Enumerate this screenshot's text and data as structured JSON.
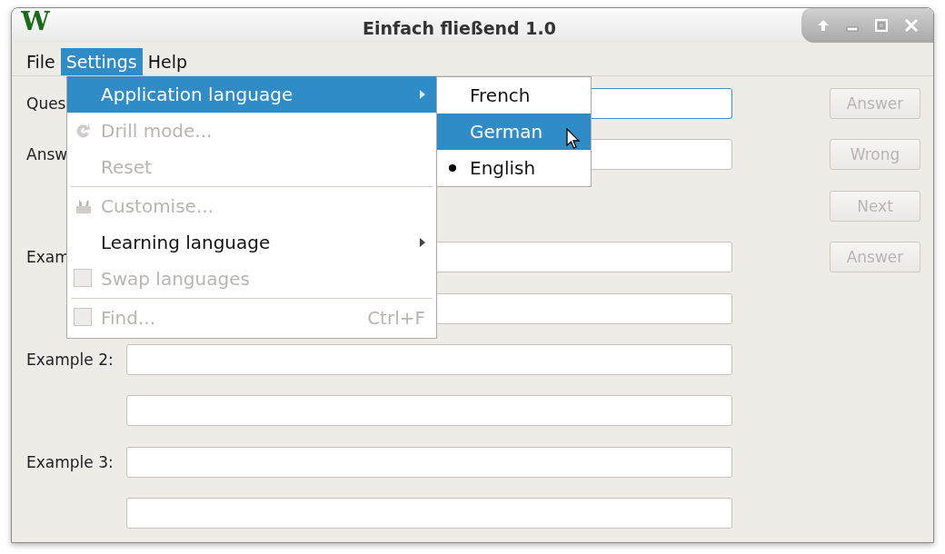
{
  "window": {
    "logo": "W",
    "title": "Einfach fließend 1.0"
  },
  "menubar": [
    {
      "label": "File",
      "selected": false
    },
    {
      "label": "Settings",
      "selected": true
    },
    {
      "label": "Help",
      "selected": false
    }
  ],
  "form": {
    "rows": [
      {
        "label": "Ques",
        "kind": "field",
        "focused": true
      },
      {
        "label": "Answ",
        "kind": "field",
        "focused": false
      },
      {
        "kind": "blank"
      },
      {
        "label": "Exam",
        "kind": "field",
        "focused": false
      },
      {
        "kind": "field",
        "focused": false
      },
      {
        "label": "Example 2:",
        "kind": "field",
        "focused": false
      },
      {
        "kind": "field",
        "focused": false
      },
      {
        "label": "Example 3:",
        "kind": "field",
        "focused": false
      },
      {
        "kind": "field",
        "focused": false
      }
    ],
    "buttons": [
      {
        "label": "Answer",
        "disabled": true
      },
      {
        "label": "Wrong",
        "disabled": true
      },
      {
        "label": "Next",
        "disabled": true
      },
      {
        "label": "Answer",
        "disabled": true
      }
    ]
  },
  "settings_menu": {
    "sections": [
      [
        {
          "label": "Application language",
          "kind": "submenu",
          "disabled": false,
          "selected": true
        },
        {
          "label": "Drill mode...",
          "kind": "drill",
          "disabled": true,
          "selected": false
        },
        {
          "label": "Reset",
          "kind": "plain",
          "disabled": true,
          "selected": false
        }
      ],
      [
        {
          "label": "Customise...",
          "kind": "customise",
          "disabled": true,
          "selected": false
        },
        {
          "label": "Learning language",
          "kind": "submenu",
          "disabled": false,
          "selected": false
        },
        {
          "label": "Swap languages",
          "kind": "checkbox",
          "checked": false,
          "disabled": true,
          "selected": false
        }
      ],
      [
        {
          "label": "Find...",
          "kind": "checkbox",
          "checked": false,
          "disabled": true,
          "selected": false,
          "shortcut": "Ctrl+F"
        }
      ]
    ]
  },
  "language_submenu": [
    {
      "label": "French",
      "selected": false,
      "checked": false
    },
    {
      "label": "German",
      "selected": true,
      "checked": false
    },
    {
      "label": "English",
      "selected": false,
      "checked": true
    }
  ]
}
